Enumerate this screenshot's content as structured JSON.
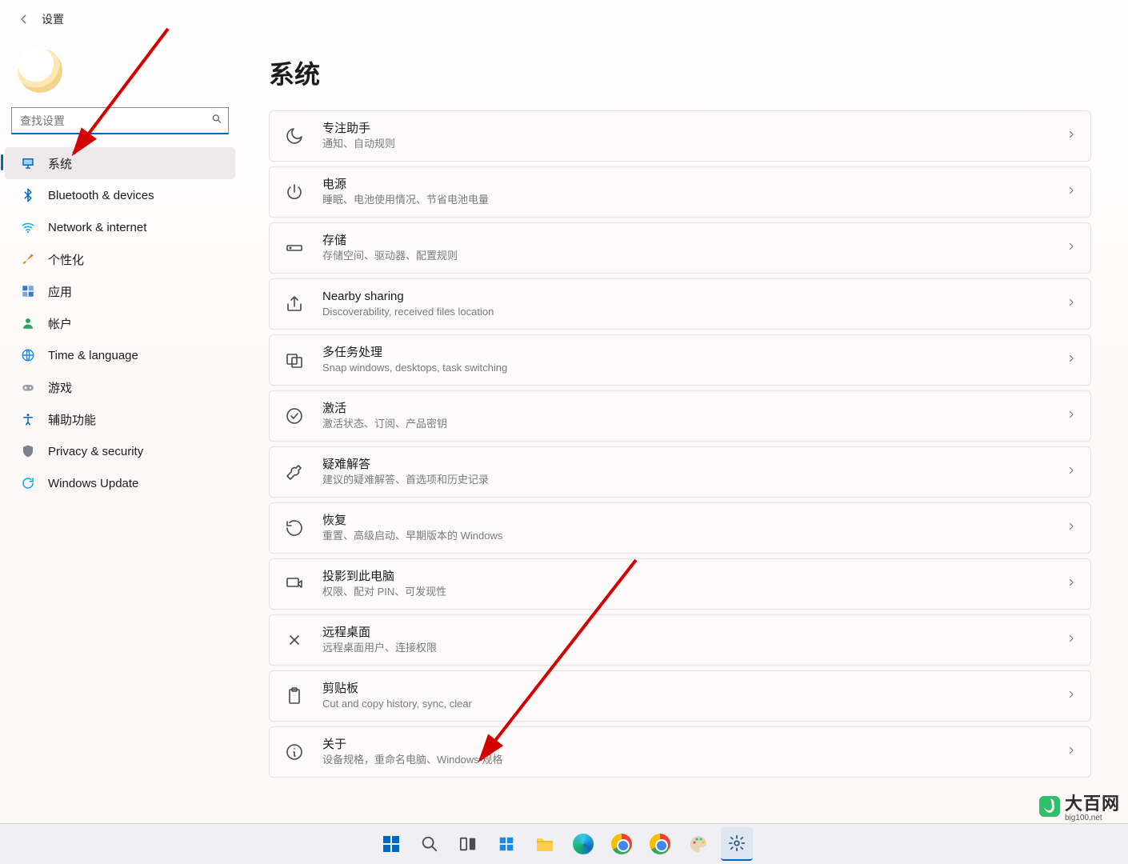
{
  "header": {
    "title": "设置"
  },
  "search": {
    "placeholder": "查找设置"
  },
  "nav": {
    "items": [
      {
        "key": "system",
        "label": "系统",
        "icon": "monitor",
        "color": "#0067c0",
        "selected": true
      },
      {
        "key": "bluetooth",
        "label": "Bluetooth & devices",
        "icon": "bluetooth",
        "color": "#0067c0",
        "selected": false
      },
      {
        "key": "network",
        "label": "Network & internet",
        "icon": "wifi",
        "color": "#00b0ff",
        "selected": false
      },
      {
        "key": "personalize",
        "label": "个性化",
        "icon": "brush",
        "color": "#e67e22",
        "selected": false
      },
      {
        "key": "apps",
        "label": "应用",
        "icon": "apps",
        "color": "#3a7bd5",
        "selected": false
      },
      {
        "key": "accounts",
        "label": "帐户",
        "icon": "person",
        "color": "#2aa461",
        "selected": false
      },
      {
        "key": "time",
        "label": "Time & language",
        "icon": "globe",
        "color": "#1e88e5",
        "selected": false
      },
      {
        "key": "gaming",
        "label": "游戏",
        "icon": "gamepad",
        "color": "#9aa0a6",
        "selected": false
      },
      {
        "key": "accessibility",
        "label": "辅助功能",
        "icon": "access",
        "color": "#0067c0",
        "selected": false
      },
      {
        "key": "privacy",
        "label": "Privacy & security",
        "icon": "shield",
        "color": "#7c828a",
        "selected": false
      },
      {
        "key": "update",
        "label": "Windows Update",
        "icon": "update",
        "color": "#00a8e8",
        "selected": false
      }
    ]
  },
  "page": {
    "title": "系统",
    "cards": [
      {
        "key": "focus",
        "icon": "moon",
        "title": "专注助手",
        "sub": "通知、自动规则"
      },
      {
        "key": "power",
        "icon": "power",
        "title": "电源",
        "sub": "睡眠、电池使用情况、节省电池电量"
      },
      {
        "key": "storage",
        "icon": "storage",
        "title": "存储",
        "sub": "存储空间、驱动器、配置规则"
      },
      {
        "key": "nearby",
        "icon": "share",
        "title": "Nearby sharing",
        "sub": "Discoverability, received files location"
      },
      {
        "key": "multitask",
        "icon": "multitask",
        "title": "多任务处理",
        "sub": "Snap windows, desktops, task switching"
      },
      {
        "key": "activation",
        "icon": "check",
        "title": "激活",
        "sub": "激活状态、订阅、产品密钥"
      },
      {
        "key": "troubleshoot",
        "icon": "wrench",
        "title": "疑难解答",
        "sub": "建议的疑难解答、首选项和历史记录"
      },
      {
        "key": "recovery",
        "icon": "recovery",
        "title": "恢复",
        "sub": "重置、高级启动、早期版本的 Windows"
      },
      {
        "key": "projecting",
        "icon": "project",
        "title": "投影到此电脑",
        "sub": "权限、配对 PIN、可发现性"
      },
      {
        "key": "remote",
        "icon": "remote",
        "title": "远程桌面",
        "sub": "远程桌面用户、连接权限"
      },
      {
        "key": "clipboard",
        "icon": "clipboard",
        "title": "剪贴板",
        "sub": "Cut and copy history, sync, clear"
      },
      {
        "key": "about",
        "icon": "info",
        "title": "关于",
        "sub": "设备规格，重命名电脑、Windows 规格"
      }
    ]
  },
  "watermark": {
    "main": "大百网",
    "sub": "big100.net"
  },
  "annotation": {
    "color": "#d40000"
  }
}
